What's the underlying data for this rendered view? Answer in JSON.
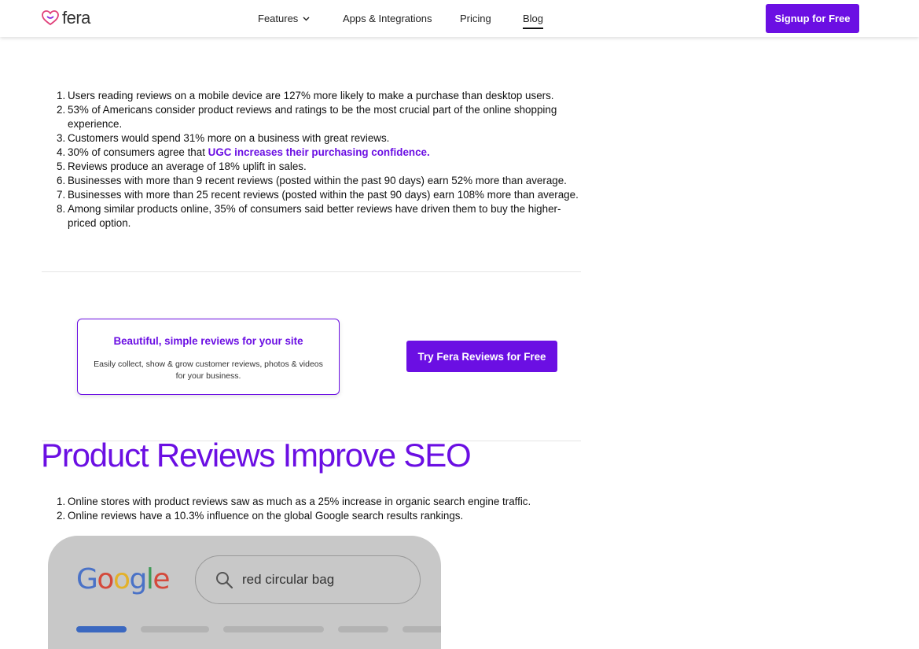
{
  "header": {
    "logo_text": "fera",
    "nav": {
      "features": "Features",
      "apps": "Apps & Integrations",
      "pricing": "Pricing",
      "blog": "Blog"
    },
    "signup_label": "Signup for Free"
  },
  "stats_list": [
    {
      "num": "1.",
      "text": "Users reading reviews on a mobile device are 127% more likely to make a purchase than desktop users."
    },
    {
      "num": "2.",
      "text": "53% of Americans consider product reviews and ratings to be the most crucial part of the online shopping experience."
    },
    {
      "num": "3.",
      "text": "Customers would spend 31% more on a business with great reviews."
    },
    {
      "num": "4.",
      "text_before": "30% of consumers agree that ",
      "link": "UGC increases their purchasing confidence."
    },
    {
      "num": "5.",
      "text": "Reviews produce an average of 18% uplift in sales."
    },
    {
      "num": "6.",
      "text": "Businesses with more than 9 recent reviews (posted within the past 90 days) earn 52% more than average."
    },
    {
      "num": "7.",
      "text": "Businesses with more than 25 recent reviews (posted within the past 90 days) earn 108% more than average."
    },
    {
      "num": "8.",
      "text": "Among similar products online, 35% of consumers said better reviews have driven them to buy the higher-priced option."
    }
  ],
  "promo": {
    "title": "Beautiful, simple reviews for your site",
    "description": "Easily collect, show & grow customer reviews, photos & videos for your business.",
    "cta_label": "Try Fera Reviews for Free"
  },
  "seo_section": {
    "heading": "Product Reviews Improve SEO",
    "items": [
      {
        "num": "1.",
        "text": "Online stores with product reviews saw as much as a 25% increase in organic search engine traffic."
      },
      {
        "num": "2.",
        "text": "Online reviews have a 10.3% influence on the global Google search results rankings."
      }
    ]
  },
  "google_image": {
    "logo": [
      "G",
      "o",
      "o",
      "g",
      "l",
      "e"
    ],
    "search_text": "red circular bag"
  },
  "colors": {
    "brand": "#6b0fe3"
  }
}
